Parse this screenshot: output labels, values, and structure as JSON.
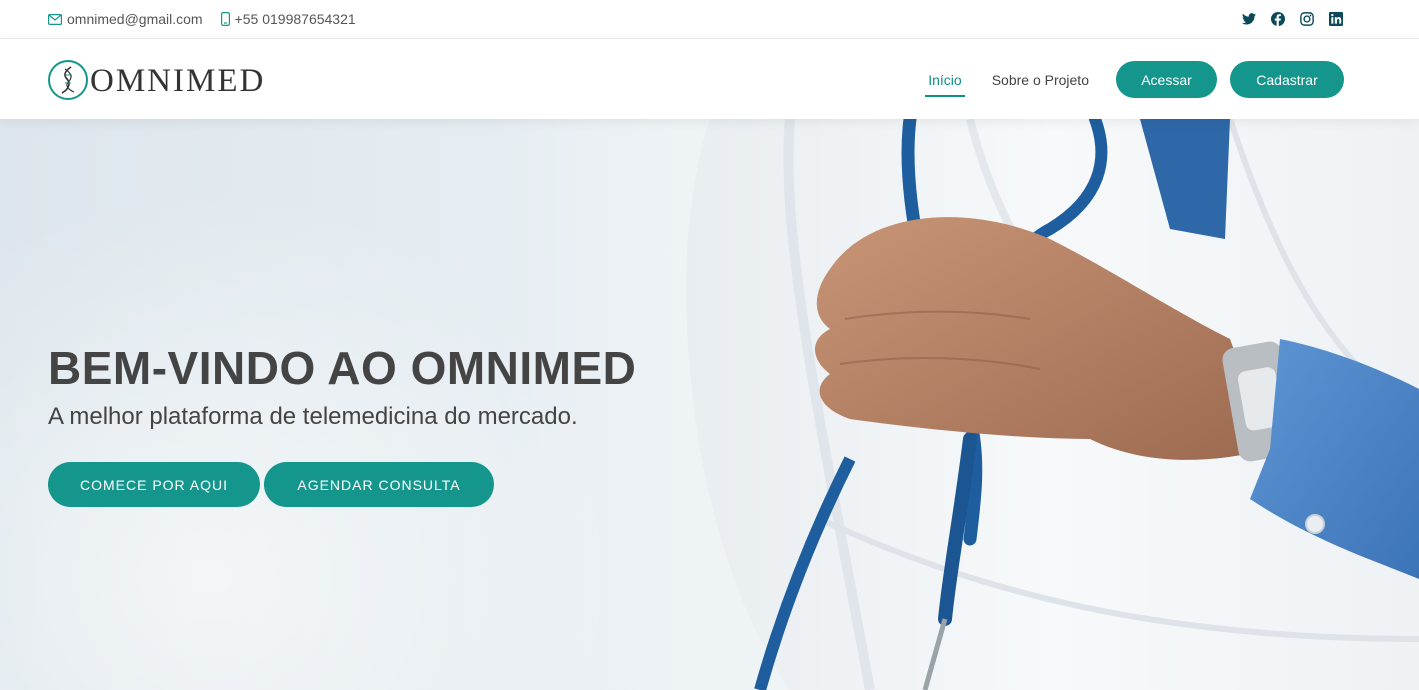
{
  "topbar": {
    "email": "omnimed@gmail.com",
    "phone": "+55 019987654321",
    "social": [
      "twitter-icon",
      "facebook-icon",
      "instagram-icon",
      "linkedin-icon"
    ]
  },
  "header": {
    "logo_text": "OMNIMED",
    "nav": {
      "inicio": "Início",
      "sobre": "Sobre o Projeto",
      "acessar": "Acessar",
      "cadastrar": "Cadastrar"
    }
  },
  "hero": {
    "title": "BEM-VINDO AO OMNIMED",
    "subtitle": "A melhor plataforma de telemedicina do mercado.",
    "cta_primary": "COMECE POR AQUI",
    "cta_secondary": "AGENDAR CONSULTA"
  },
  "colors": {
    "accent": "#14968c",
    "text": "#444444"
  }
}
